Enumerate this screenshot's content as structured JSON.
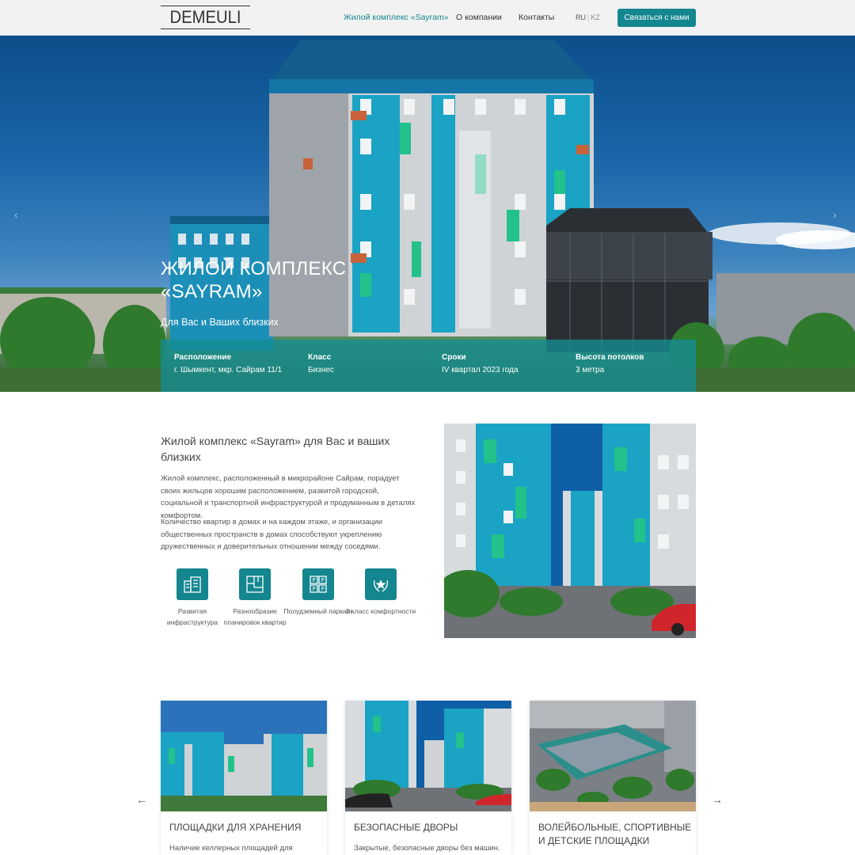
{
  "header": {
    "logo": "DEMEULI",
    "nav": [
      "Жилой комплекс «Sayram»",
      "О компании",
      "Контакты"
    ],
    "lang_ru": "RU",
    "lang_sep": "|",
    "lang_kz": "KZ",
    "cta_label": "Связаться с нами"
  },
  "hero": {
    "title": "ЖИЛОЙ КОМПЛЕКС «SAYRAM»",
    "subtitle": "Для Вас и Ваших близких",
    "prev_arrow": "‹",
    "next_arrow": "›",
    "info": [
      {
        "key": "Расположение",
        "value": "г. Шымкент, мкр. Сайрам 11/1"
      },
      {
        "key": "Класс",
        "value": "Бизнес"
      },
      {
        "key": "Сроки",
        "value": "IV квартал 2023 года"
      },
      {
        "key": "Высота потолков",
        "value": "3 метра"
      }
    ]
  },
  "about": {
    "title": "Жилой комплекс «Sayram» для Вас и ваших близких",
    "p1": "Жилой комплекс, расположенный в микрорайоне Сайрам, порадует своих жильцов хорошим расположением, развитой городской, социальной и транспортной инфраструктурой и продуманным в деталях комфортом.",
    "p2": "Количество квартир в домах и на каждом этаже, и организации общественных пространств в домах способствуют укреплению дружественных и доверительных отношении между соседями.",
    "features": [
      {
        "label": "Развитая инфраструктура",
        "icon": "building-icon"
      },
      {
        "label": "Разнообразие планировок квартир",
        "icon": "floorplan-icon"
      },
      {
        "label": "Полудземный паркинг",
        "icon": "parking-icon"
      },
      {
        "label": "2 класс комфортности",
        "icon": "star-wreath-icon"
      }
    ]
  },
  "cards": {
    "prev_arrow": "←",
    "next_arrow": "→",
    "items": [
      {
        "title": "ПЛОЩАДКИ ДЛЯ ХРАНЕНИЯ",
        "desc": "Наличие келлерных площадей для"
      },
      {
        "title": "БЕЗОПАСНЫЕ ДВОРЫ",
        "desc": "Закрытые, безопасные дворы без машин."
      },
      {
        "title": "ВОЛЕЙБОЛЬНЫЕ, СПОРТИВНЫЕ И ДЕТСКИЕ ПЛОЩАДКИ",
        "desc": ""
      }
    ]
  },
  "colors": {
    "accent": "#13868f",
    "header_bg": "#f2f2f2"
  }
}
